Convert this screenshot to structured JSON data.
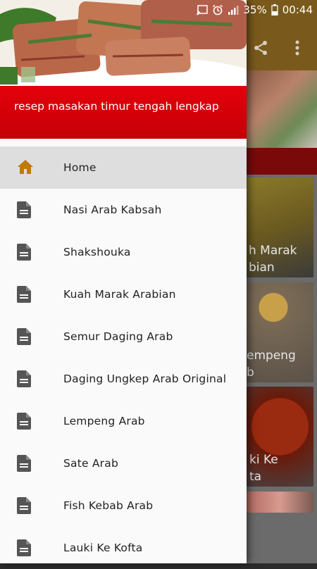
{
  "status_bar": {
    "battery_percent": "35%",
    "time": "00:44",
    "icons": [
      "cast-icon",
      "alarm-icon",
      "signal-icon",
      "battery-icon"
    ]
  },
  "drawer": {
    "header_title": "resep masakan timur tengah lengkap",
    "menu_items": [
      {
        "label": "Home",
        "icon": "home-icon",
        "active": true
      },
      {
        "label": "Nasi Arab Kabsah",
        "icon": "document-icon"
      },
      {
        "label": "Shakshouka",
        "icon": "document-icon"
      },
      {
        "label": "Kuah Marak Arabian",
        "icon": "document-icon"
      },
      {
        "label": "Semur Daging Arab",
        "icon": "document-icon"
      },
      {
        "label": "Daging Ungkep Arab Original",
        "icon": "document-icon"
      },
      {
        "label": "Lempeng Arab",
        "icon": "document-icon"
      },
      {
        "label": "Sate Arab",
        "icon": "document-icon"
      },
      {
        "label": "Fish Kebab Arab",
        "icon": "document-icon"
      },
      {
        "label": "Lauki Ke Kofta",
        "icon": "document-icon"
      }
    ]
  },
  "background_app": {
    "actions": [
      "share-icon",
      "overflow-menu-icon"
    ],
    "cards": [
      {
        "title_line1": "h Marak",
        "title_line2": "bian"
      },
      {
        "title_line1": "empeng",
        "title_line2": "b"
      },
      {
        "title_line1": "ki Ke",
        "title_line2": "ta"
      }
    ]
  },
  "colors": {
    "header_red": "#d9000a",
    "home_icon": "#c17a00",
    "doc_icon": "#555555",
    "active_row": "#dedede"
  }
}
